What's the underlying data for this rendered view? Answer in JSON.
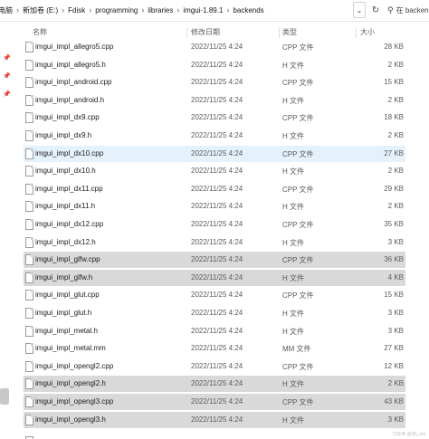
{
  "breadcrumb": {
    "items": [
      "此电脑",
      "新加卷 (E:)",
      "Fdisk",
      "programming",
      "libraries",
      "imgui-1.89.1",
      "backends"
    ]
  },
  "search": {
    "placeholder": "在 backends"
  },
  "columns": {
    "name": "名称",
    "date": "修改日期",
    "type": "类型",
    "size": "大小"
  },
  "files": [
    {
      "name": "imgui_impl_allegro5.cpp",
      "date": "2022/11/25 4:24",
      "type": "CPP 文件",
      "size": "28 KB",
      "state": ""
    },
    {
      "name": "imgui_impl_allegro5.h",
      "date": "2022/11/25 4:24",
      "type": "H 文件",
      "size": "2 KB",
      "state": ""
    },
    {
      "name": "imgui_impl_android.cpp",
      "date": "2022/11/25 4:24",
      "type": "CPP 文件",
      "size": "15 KB",
      "state": ""
    },
    {
      "name": "imgui_impl_android.h",
      "date": "2022/11/25 4:24",
      "type": "H 文件",
      "size": "2 KB",
      "state": ""
    },
    {
      "name": "imgui_impl_dx9.cpp",
      "date": "2022/11/25 4:24",
      "type": "CPP 文件",
      "size": "18 KB",
      "state": ""
    },
    {
      "name": "imgui_impl_dx9.h",
      "date": "2022/11/25 4:24",
      "type": "H 文件",
      "size": "2 KB",
      "state": ""
    },
    {
      "name": "imgui_impl_dx10.cpp",
      "date": "2022/11/25 4:24",
      "type": "CPP 文件",
      "size": "27 KB",
      "state": "hover"
    },
    {
      "name": "imgui_impl_dx10.h",
      "date": "2022/11/25 4:24",
      "type": "H 文件",
      "size": "2 KB",
      "state": ""
    },
    {
      "name": "imgui_impl_dx11.cpp",
      "date": "2022/11/25 4:24",
      "type": "CPP 文件",
      "size": "29 KB",
      "state": ""
    },
    {
      "name": "imgui_impl_dx11.h",
      "date": "2022/11/25 4:24",
      "type": "H 文件",
      "size": "2 KB",
      "state": ""
    },
    {
      "name": "imgui_impl_dx12.cpp",
      "date": "2022/11/25 4:24",
      "type": "CPP 文件",
      "size": "35 KB",
      "state": ""
    },
    {
      "name": "imgui_impl_dx12.h",
      "date": "2022/11/25 4:24",
      "type": "H 文件",
      "size": "3 KB",
      "state": ""
    },
    {
      "name": "imgui_impl_glfw.cpp",
      "date": "2022/11/25 4:24",
      "type": "CPP 文件",
      "size": "36 KB",
      "state": "selected"
    },
    {
      "name": "imgui_impl_glfw.h",
      "date": "2022/11/25 4:24",
      "type": "H 文件",
      "size": "4 KB",
      "state": "selected"
    },
    {
      "name": "imgui_impl_glut.cpp",
      "date": "2022/11/25 4:24",
      "type": "CPP 文件",
      "size": "15 KB",
      "state": ""
    },
    {
      "name": "imgui_impl_glut.h",
      "date": "2022/11/25 4:24",
      "type": "H 文件",
      "size": "3 KB",
      "state": ""
    },
    {
      "name": "imgui_impl_metal.h",
      "date": "2022/11/25 4:24",
      "type": "H 文件",
      "size": "3 KB",
      "state": ""
    },
    {
      "name": "imgui_impl_metal.mm",
      "date": "2022/11/25 4:24",
      "type": "MM 文件",
      "size": "27 KB",
      "state": ""
    },
    {
      "name": "imgui_impl_opengl2.cpp",
      "date": "2022/11/25 4:24",
      "type": "CPP 文件",
      "size": "12 KB",
      "state": ""
    },
    {
      "name": "imgui_impl_opengl2.h",
      "date": "2022/11/25 4:24",
      "type": "H 文件",
      "size": "2 KB",
      "state": "selected"
    },
    {
      "name": "imgui_impl_opengl3.cpp",
      "date": "2022/11/25 4:24",
      "type": "CPP 文件",
      "size": "43 KB",
      "state": "selected"
    },
    {
      "name": "imgui_impl_opengl3.h",
      "date": "2022/11/25 4:24",
      "type": "H 文件",
      "size": "3 KB",
      "state": "selected"
    }
  ],
  "colors": {
    "hover": "#e5f1fb",
    "selected": "#d9d9d9"
  },
  "watermark": "CSDN @Sh_txx"
}
